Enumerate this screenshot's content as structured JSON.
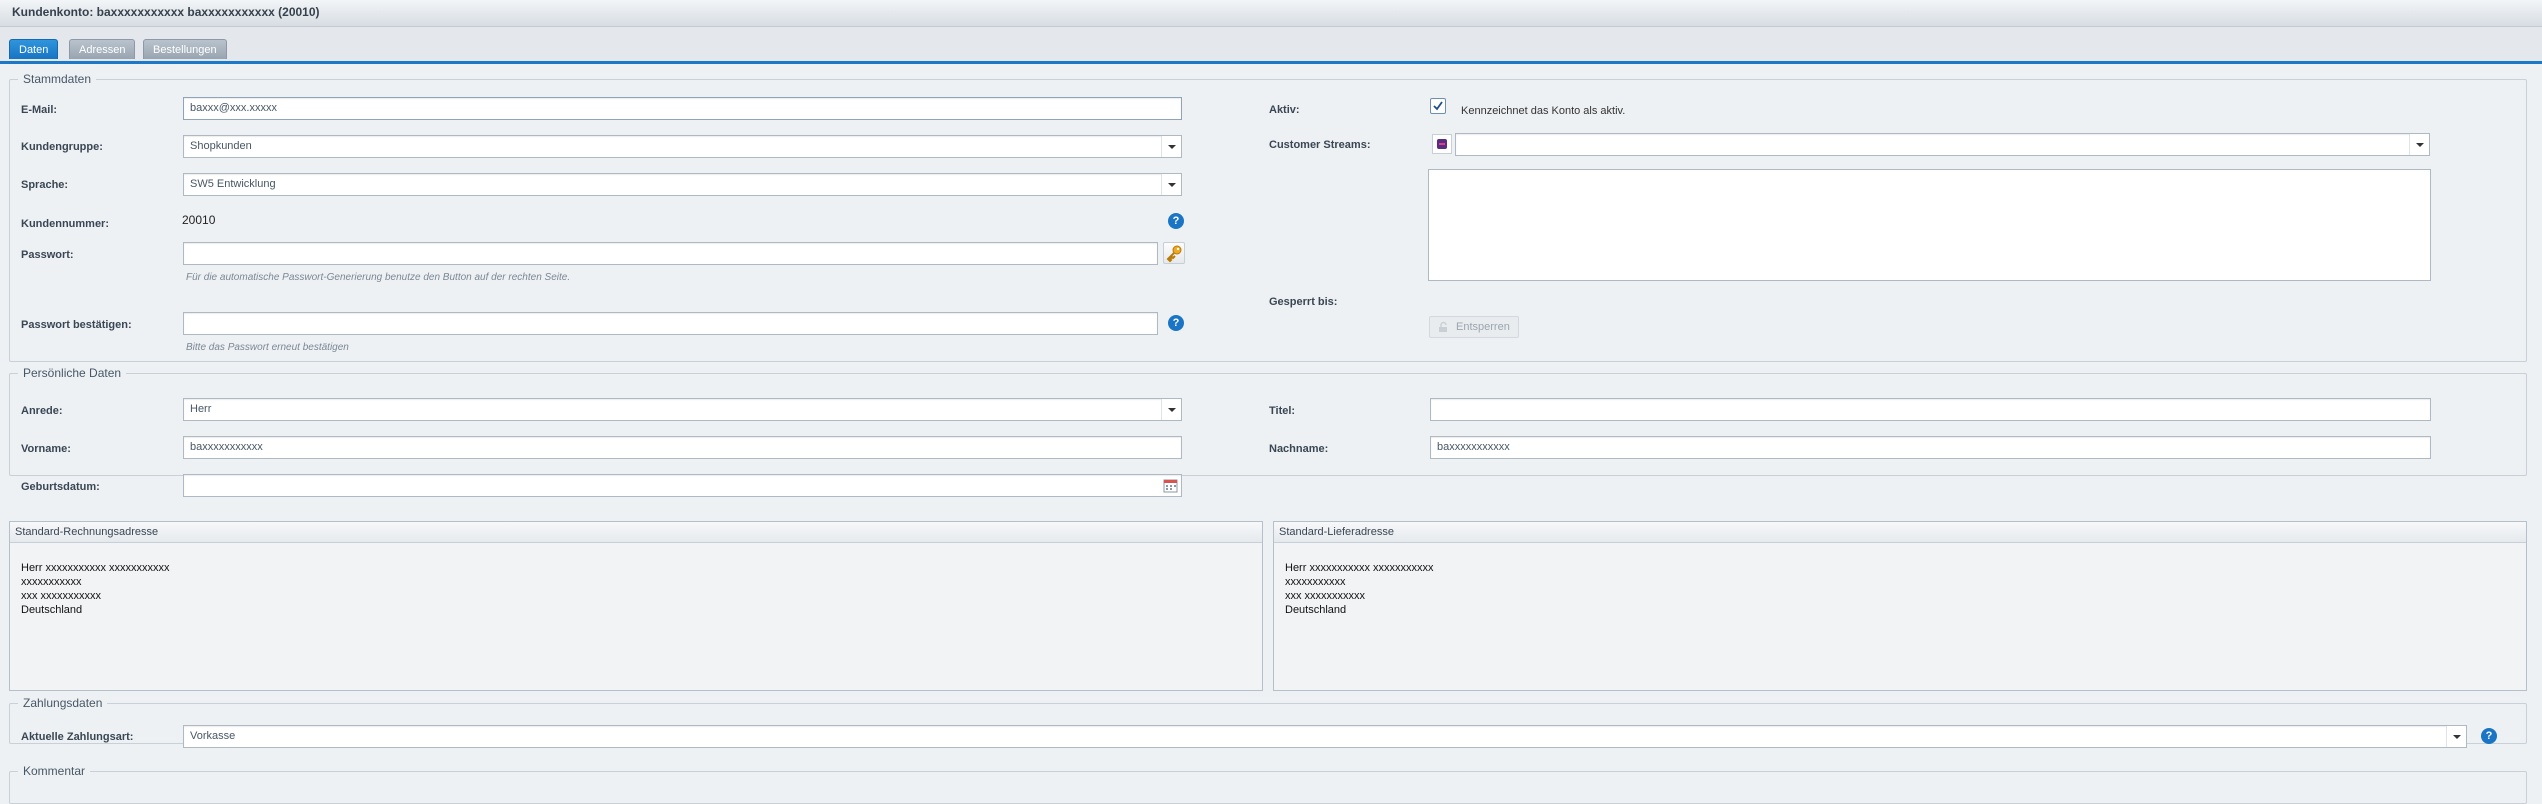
{
  "window": {
    "title": "Kundenkonto: baxxxxxxxxxxx baxxxxxxxxxxx (20010)"
  },
  "tabs": [
    {
      "label": "Daten",
      "active": true
    },
    {
      "label": "Adressen",
      "active": false
    },
    {
      "label": "Bestellungen",
      "active": false
    }
  ],
  "stammdaten": {
    "legend": "Stammdaten",
    "email": {
      "label": "E-Mail:",
      "value": "baxxx@xxx.xxxxx"
    },
    "kundengruppe": {
      "label": "Kundengruppe:",
      "value": "Shopkunden"
    },
    "sprache": {
      "label": "Sprache:",
      "value": "SW5 Entwicklung"
    },
    "kundennummer": {
      "label": "Kundennummer:",
      "value": "20010"
    },
    "passwort": {
      "label": "Passwort:",
      "value": "",
      "hint": "Für die automatische Passwort-Generierung benutze den Button auf der rechten Seite."
    },
    "passwort_bestaetigen": {
      "label": "Passwort bestätigen:",
      "value": "",
      "hint": "Bitte das Passwort erneut bestätigen"
    },
    "aktiv": {
      "label": "Aktiv:",
      "checked": true,
      "text": "Kennzeichnet das Konto als aktiv."
    },
    "customer_streams": {
      "label": "Customer Streams:",
      "value": ""
    },
    "gesperrt_bis": {
      "label": "Gesperrt bis:",
      "button": "Entsperren"
    }
  },
  "persoenliche_daten": {
    "legend": "Persönliche Daten",
    "anrede": {
      "label": "Anrede:",
      "value": "Herr"
    },
    "titel": {
      "label": "Titel:",
      "value": ""
    },
    "vorname": {
      "label": "Vorname:",
      "value": "baxxxxxxxxxxx"
    },
    "nachname": {
      "label": "Nachname:",
      "value": "baxxxxxxxxxxx"
    },
    "geburtsdatum": {
      "label": "Geburtsdatum:",
      "value": ""
    }
  },
  "rechnungsadresse": {
    "title": "Standard-Rechnungsadresse",
    "lines": [
      "Herr xxxxxxxxxxx xxxxxxxxxxx",
      "xxxxxxxxxxx",
      "xxx xxxxxxxxxxx",
      "Deutschland"
    ]
  },
  "lieferadresse": {
    "title": "Standard-Lieferadresse",
    "lines": [
      "Herr xxxxxxxxxxx xxxxxxxxxxx",
      "xxxxxxxxxxx",
      "xxx xxxxxxxxxxx",
      "Deutschland"
    ]
  },
  "zahlungsdaten": {
    "legend": "Zahlungsdaten",
    "zahlungsart": {
      "label": "Aktuelle Zahlungsart:",
      "value": "Vorkasse"
    }
  },
  "kommentar": {
    "legend": "Kommentar"
  },
  "icons": {
    "help": "?"
  }
}
